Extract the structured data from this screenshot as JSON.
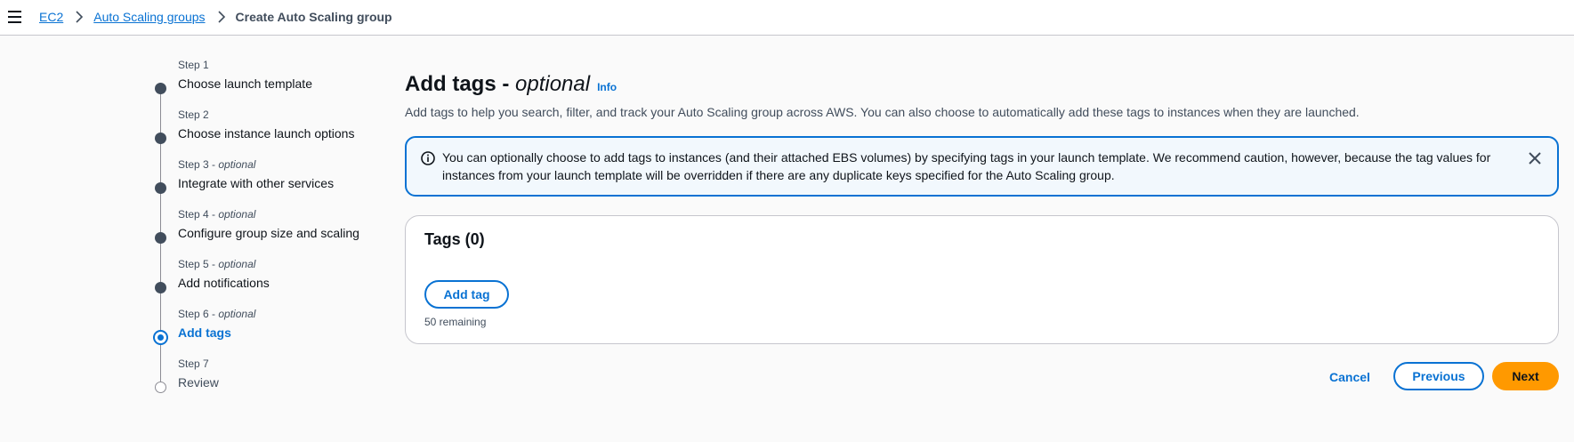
{
  "breadcrumb": {
    "items": [
      "EC2",
      "Auto Scaling groups"
    ],
    "current": "Create Auto Scaling group"
  },
  "steps": [
    {
      "num": "Step 1",
      "optional": "",
      "title": "Choose launch template",
      "state": "completed"
    },
    {
      "num": "Step 2",
      "optional": "",
      "title": "Choose instance launch options",
      "state": "completed"
    },
    {
      "num": "Step 3",
      "optional": "optional",
      "title": "Integrate with other services",
      "state": "completed"
    },
    {
      "num": "Step 4",
      "optional": "optional",
      "title": "Configure group size and scaling",
      "state": "completed"
    },
    {
      "num": "Step 5",
      "optional": "optional",
      "title": "Add notifications",
      "state": "completed"
    },
    {
      "num": "Step 6",
      "optional": "optional",
      "title": "Add tags",
      "state": "current"
    },
    {
      "num": "Step 7",
      "optional": "",
      "title": "Review",
      "state": "future"
    }
  ],
  "main": {
    "title": "Add tags",
    "title_suffix": "optional",
    "info_label": "Info",
    "description": "Add tags to help you search, filter, and track your Auto Scaling group across AWS. You can also choose to automatically add these tags to instances when they are launched."
  },
  "alert": {
    "text": "You can optionally choose to add tags to instances (and their attached EBS volumes) by specifying tags in your launch template. We recommend caution, however, because the tag values for instances from your launch template will be overridden if there are any duplicate keys specified for the Auto Scaling group.",
    "icon": "info-icon",
    "close_icon": "close-icon"
  },
  "tags": {
    "title": "Tags (0)",
    "add_label": "Add tag",
    "remaining": "50 remaining"
  },
  "actions": {
    "cancel": "Cancel",
    "previous": "Previous",
    "next": "Next"
  },
  "colors": {
    "link": "#0972d3",
    "primary_button": "#ff9900",
    "alert_bg": "#f2f8fd",
    "step_complete": "#414d5c"
  }
}
